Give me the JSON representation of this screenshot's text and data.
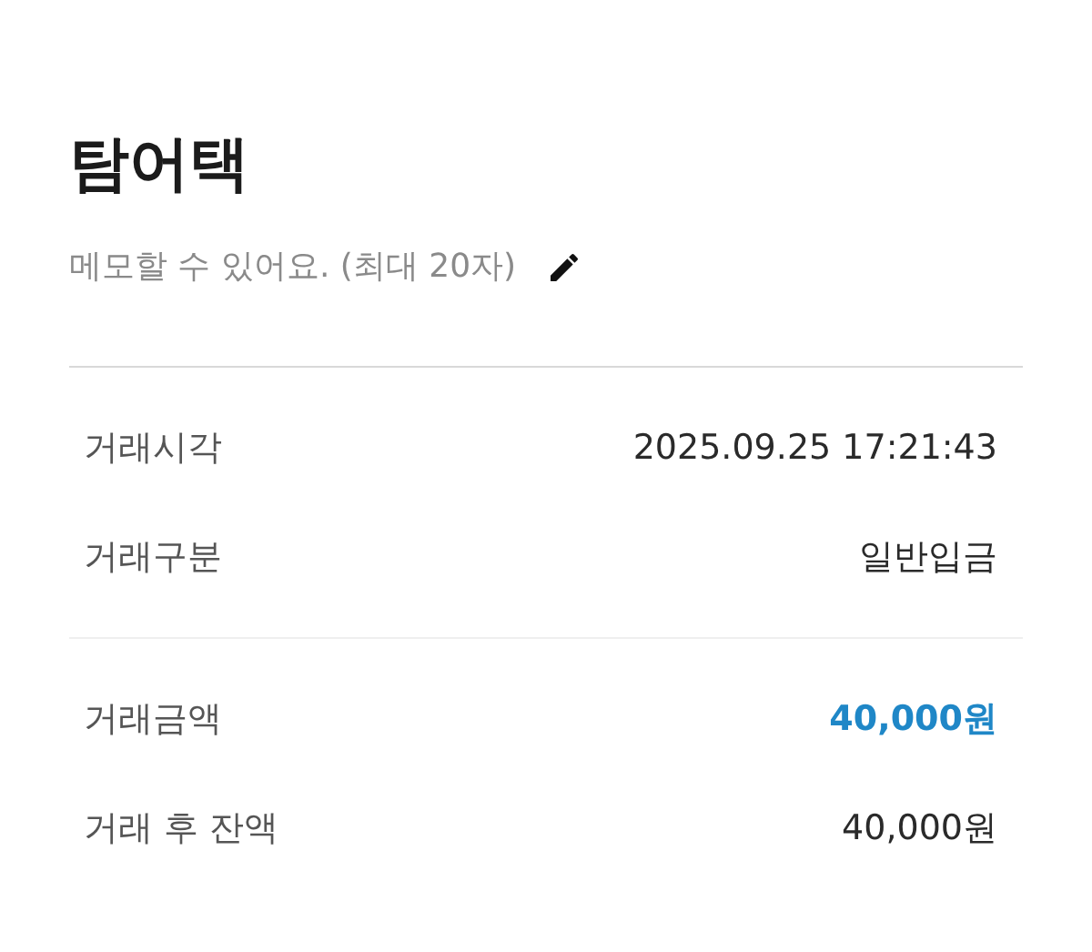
{
  "title": "탐어택",
  "memo": {
    "placeholder": "메모할 수 있어요. (최대 20자)"
  },
  "sections": [
    {
      "rows": [
        {
          "label": "거래시각",
          "value": "2025.09.25 17:21:43",
          "emphasized": false
        },
        {
          "label": "거래구분",
          "value": "일반입금",
          "emphasized": false
        }
      ]
    },
    {
      "rows": [
        {
          "label": "거래금액",
          "value": "40,000원",
          "emphasized": true
        },
        {
          "label": "거래 후 잔액",
          "value": "40,000원",
          "emphasized": false
        }
      ]
    }
  ]
}
